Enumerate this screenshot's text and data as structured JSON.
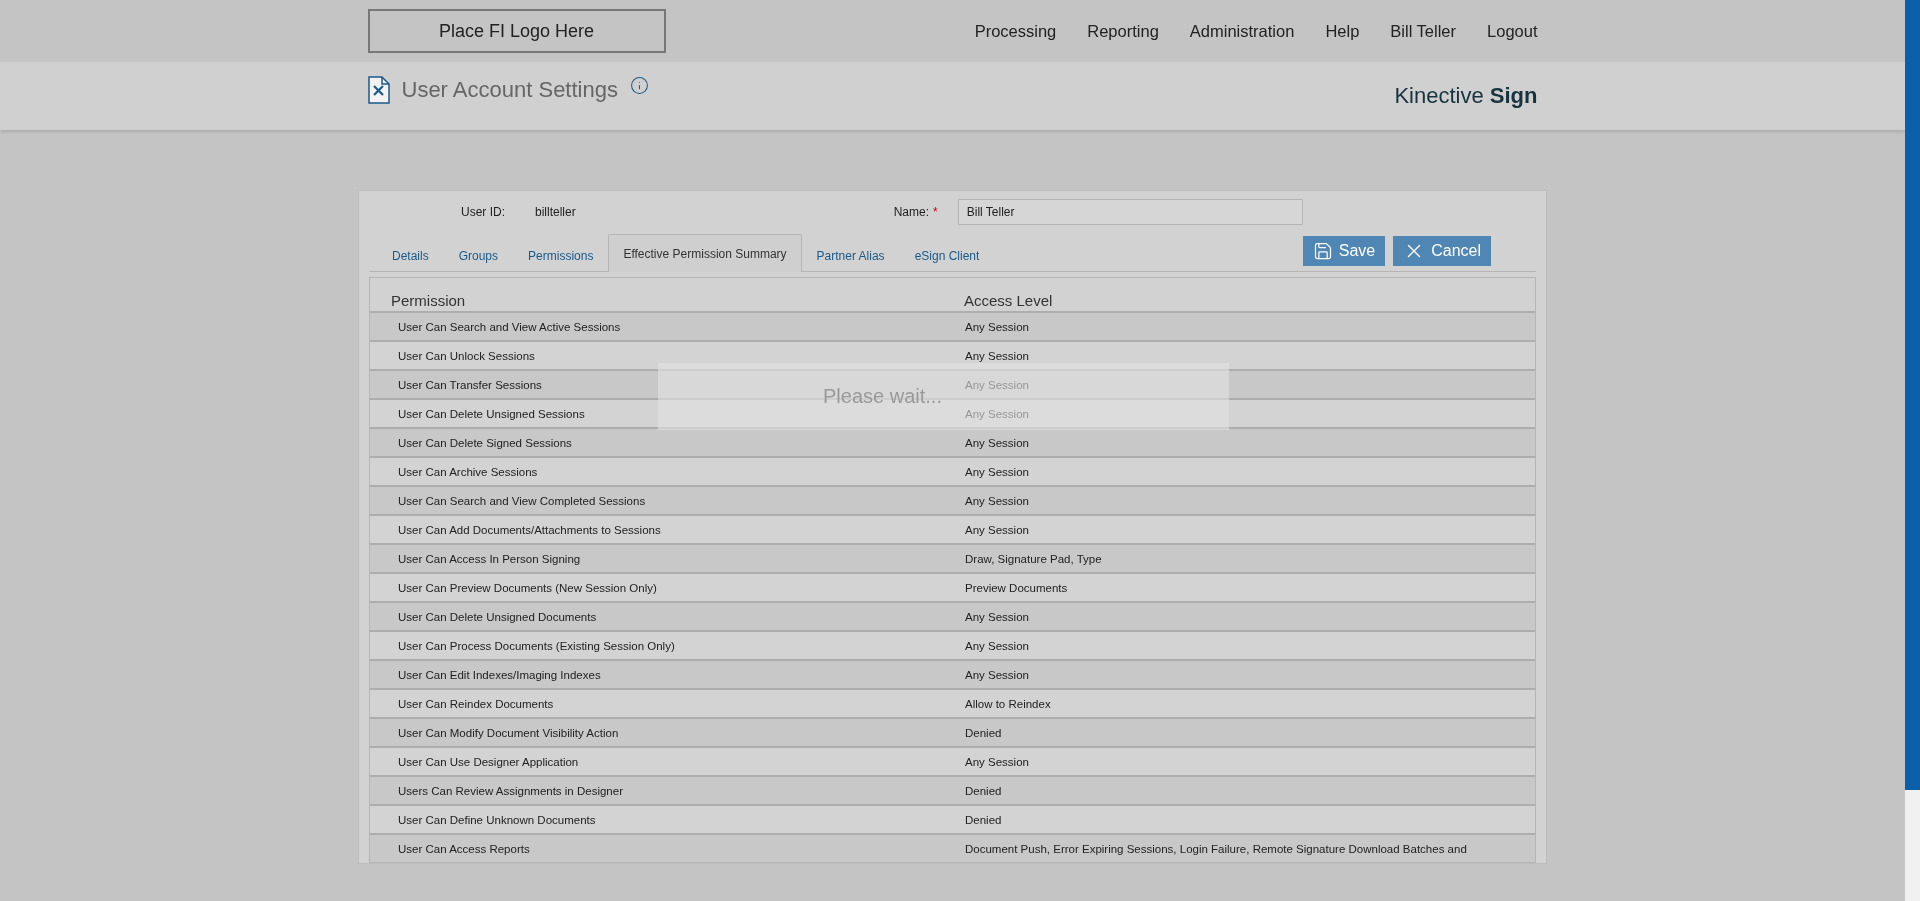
{
  "header": {
    "logo": "Place FI Logo Here",
    "nav": [
      "Processing",
      "Reporting",
      "Administration",
      "Help",
      "Bill Teller",
      "Logout"
    ]
  },
  "page": {
    "title": "User Account Settings",
    "brand": "Kinective **Sign**"
  },
  "form": {
    "user_id_label": "User ID:",
    "user_id": "billteller",
    "name_label": "Name:",
    "required_mark": "*",
    "name_value": "Bill Teller"
  },
  "tabs": [
    {
      "label": "Details",
      "selected": false
    },
    {
      "label": "Groups",
      "selected": false
    },
    {
      "label": "Permissions",
      "selected": false
    },
    {
      "label": "Effective Permission Summary",
      "selected": true
    },
    {
      "label": "Partner Alias",
      "selected": false
    },
    {
      "label": "eSign Client",
      "selected": false
    }
  ],
  "buttons": [
    {
      "label": "Save",
      "kind": "save"
    },
    {
      "label": "Cancel",
      "kind": "cancel"
    }
  ],
  "table": {
    "columns": [
      "Permission",
      "Access Level"
    ],
    "rows": [
      {
        "permission": "User Can Search and View Active Sessions",
        "access": "Any Session"
      },
      {
        "permission": "User Can Unlock Sessions",
        "access": "Any Session"
      },
      {
        "permission": "User Can Transfer Sessions",
        "access": "Any Session"
      },
      {
        "permission": "User Can Delete Unsigned Sessions",
        "access": "Any Session"
      },
      {
        "permission": "User Can Delete Signed Sessions",
        "access": "Any Session"
      },
      {
        "permission": "User Can Archive Sessions",
        "access": "Any Session"
      },
      {
        "permission": "User Can Search and View Completed Sessions",
        "access": "Any Session"
      },
      {
        "permission": "User Can Add Documents/Attachments to Sessions",
        "access": "Any Session"
      },
      {
        "permission": "User Can Access In Person Signing",
        "access": "Draw, Signature Pad, Type"
      },
      {
        "permission": "User Can Preview Documents (New Session Only)",
        "access": "Preview Documents"
      },
      {
        "permission": "User Can Delete Unsigned Documents",
        "access": "Any Session"
      },
      {
        "permission": "User Can Process Documents (Existing Session Only)",
        "access": "Any Session"
      },
      {
        "permission": "User Can Edit Indexes/Imaging Indexes",
        "access": "Any Session"
      },
      {
        "permission": "User Can Reindex Documents",
        "access": "Allow to Reindex"
      },
      {
        "permission": "User Can Modify Document Visibility Action",
        "access": "Denied"
      },
      {
        "permission": "User Can Use Designer Application",
        "access": "Any Session"
      },
      {
        "permission": "Users Can Review Assignments in Designer",
        "access": "Denied"
      },
      {
        "permission": "User Can Define Unknown Documents",
        "access": "Denied"
      },
      {
        "permission": "User Can Access Reports",
        "access": "Document Push, Error Expiring Sessions, Login Failure, Remote Signature Download Batches and"
      }
    ]
  },
  "overlay": {
    "message": "Please wait..."
  }
}
